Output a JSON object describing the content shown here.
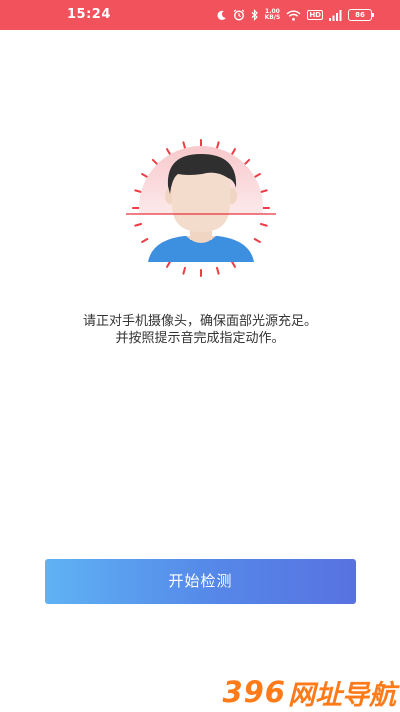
{
  "status_bar": {
    "time": "15:24",
    "network_speed_value": "1.00",
    "network_speed_unit": "KB/S",
    "hd_label": "HD",
    "battery_level": "86",
    "icons": [
      "moon-icon",
      "alarm-icon",
      "bluetooth-icon",
      "wifi-icon",
      "hd-icon",
      "signal-icon",
      "battery-icon"
    ],
    "background_color": "#f2525c"
  },
  "main": {
    "illustration": "face-scan-illustration",
    "instruction_line1": "请正对手机摄像头，确保面部光源充足。",
    "instruction_line2": "并按照提示音完成指定动作。",
    "start_button_label": "开始检测"
  },
  "watermark": {
    "digits": "396",
    "text": "网址导航"
  }
}
